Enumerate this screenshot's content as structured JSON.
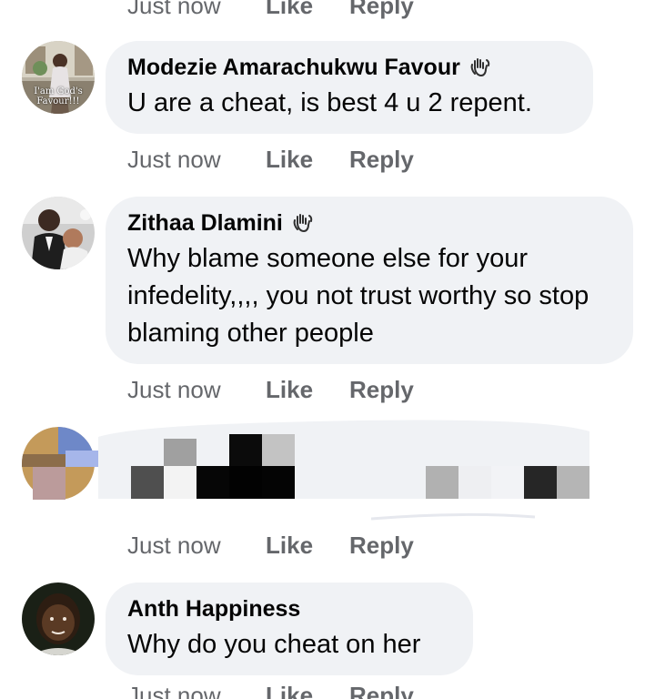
{
  "comments": [
    {
      "name": "Modezie Amarachukwu Favour",
      "text": "U are a cheat, is best 4 u 2 repent.",
      "avatar_caption": "I'am God's Favour!!!",
      "time": "Just now",
      "like": "Like",
      "reply": "Reply"
    },
    {
      "name": "Zithaa Dlamini",
      "text": "Why blame someone else for your infedelity,,,, you not trust worthy so stop blaming other people",
      "time": "Just now",
      "like": "Like",
      "reply": "Reply"
    },
    {
      "name": "",
      "text": "",
      "time": "Just now",
      "like": "Like",
      "reply": "Reply"
    },
    {
      "name": "Anth Happiness",
      "text": "Why do you cheat on her",
      "time": "Just now",
      "like": "Like",
      "reply": "Reply"
    }
  ],
  "top_actions": {
    "time": "Just now",
    "like": "Like",
    "reply": "Reply"
  },
  "colors": {
    "bubble": "#f0f2f5",
    "meta_text": "#65676b",
    "text": "#050505"
  },
  "icons": [
    "wave-icon"
  ]
}
